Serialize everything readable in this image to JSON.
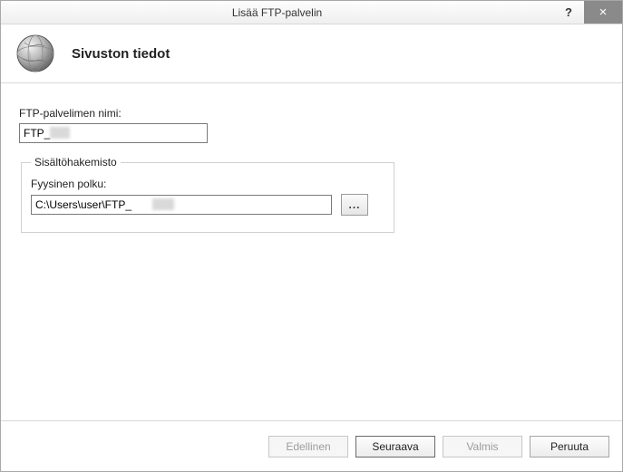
{
  "window": {
    "title": "Lisää FTP-palvelin",
    "help_label": "?",
    "close_label": "×"
  },
  "header": {
    "title": "Sivuston tiedot"
  },
  "form": {
    "server_name_label": "FTP-palvelimen nimi:",
    "server_name_value": "FTP_",
    "content_group_legend": "Sisältöhakemisto",
    "physical_path_label": "Fyysinen polku:",
    "physical_path_value": "C:\\Users\\user\\FTP_",
    "browse_label": "..."
  },
  "footer": {
    "previous": "Edellinen",
    "next": "Seuraava",
    "finish": "Valmis",
    "cancel": "Peruuta"
  }
}
